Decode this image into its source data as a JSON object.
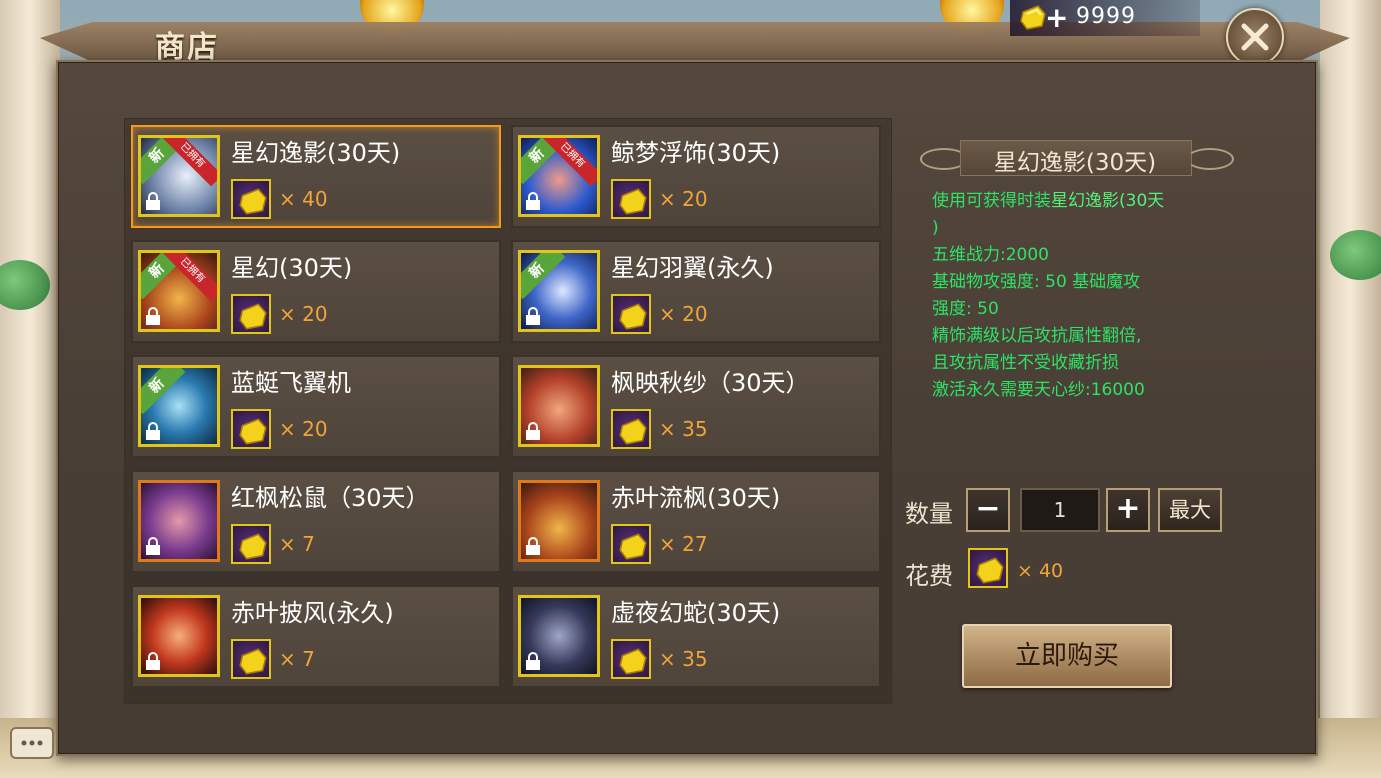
{
  "header": {
    "title": "商店",
    "currency_icon": "gold-ingot-icon",
    "currency_amount": "9999",
    "add_label": "+",
    "close_icon": "close-icon"
  },
  "items": [
    {
      "name": "星幻逸影(30天)",
      "price": "× 40",
      "new_tag": "新",
      "owned_tag": "已拥有",
      "selected": true
    },
    {
      "name": "鲸梦浮饰(30天)",
      "price": "× 20",
      "new_tag": "新",
      "owned_tag": "已拥有"
    },
    {
      "name": "星幻(30天)",
      "price": "× 20",
      "new_tag": "新",
      "owned_tag": "已拥有"
    },
    {
      "name": "星幻羽翼(永久)",
      "price": "× 20",
      "new_tag": "新"
    },
    {
      "name": "蓝蜓飞翼机",
      "price": "× 20",
      "new_tag": "新"
    },
    {
      "name": "枫映秋纱（30天）",
      "price": "× 35"
    },
    {
      "name": "红枫松鼠（30天）",
      "price": "× 7"
    },
    {
      "name": "赤叶流枫(30天)",
      "price": "× 27"
    },
    {
      "name": "赤叶披风(永久)",
      "price": "× 7"
    },
    {
      "name": "虚夜幻蛇(30天)",
      "price": "× 35"
    }
  ],
  "detail": {
    "title": "星幻逸影(30天)",
    "desc_prefix": "使用可获得时装",
    "desc_highlight": "星幻逸影(30天",
    "desc_highlight_end": ")",
    "lines": [
      "五维战力:2000",
      "基础物攻强度: 50 基础魔攻",
      "强度: 50",
      "精饰满级以后攻抗属性翻倍,",
      "且攻抗属性不受收藏折损",
      "激活永久需要天心纱:16000"
    ]
  },
  "purchase": {
    "qty_label": "数量",
    "minus": "−",
    "qty_value": "1",
    "plus": "+",
    "max_label": "最大",
    "cost_label": "花费",
    "cost_price": "× 40",
    "buy_label": "立即购买"
  },
  "colors": {
    "accent": "#f39a1c",
    "price": "#f0a43a",
    "desc": "#2ee266"
  }
}
